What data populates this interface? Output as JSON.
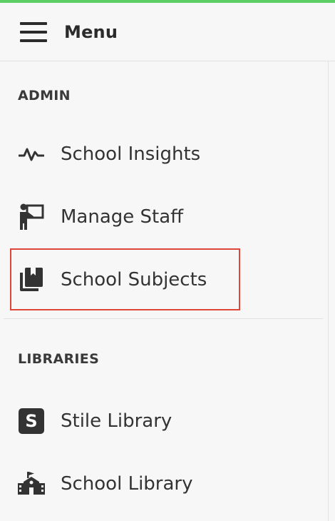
{
  "header": {
    "title": "Menu"
  },
  "sections": {
    "admin": {
      "heading": "ADMIN",
      "items": [
        {
          "label": "School Insights",
          "icon": "pulse-icon"
        },
        {
          "label": "Manage Staff",
          "icon": "teacher-board-icon"
        },
        {
          "label": "School Subjects",
          "icon": "books-icon"
        }
      ]
    },
    "libraries": {
      "heading": "LIBRARIES",
      "items": [
        {
          "label": "Stile Library",
          "icon": "stile-s-icon",
          "icon_glyph": "S"
        },
        {
          "label": "School Library",
          "icon": "school-building-icon"
        }
      ]
    }
  },
  "colors": {
    "accent": "#5bcf63",
    "highlight": "#e0453a",
    "text": "#333333",
    "background": "#f7f7f7"
  }
}
